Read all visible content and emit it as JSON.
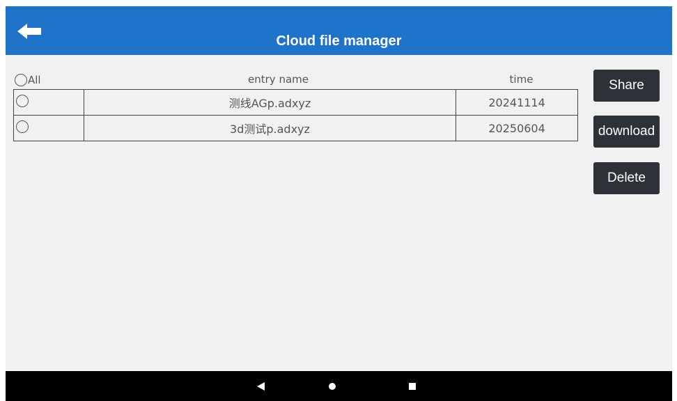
{
  "app_bar": {
    "title": "Cloud file manager",
    "back_icon": "arrow-left-icon",
    "color": "#1f73c9"
  },
  "table": {
    "select_all_label": "All",
    "columns": [
      "entry name",
      "time"
    ],
    "rows": [
      {
        "name": "测线AGp.adxyz",
        "time": "20241114",
        "selected": false
      },
      {
        "name": "3d测试p.adxyz",
        "time": "20250604",
        "selected": false
      }
    ]
  },
  "actions": {
    "share": "Share",
    "download": "download",
    "delete": "Delete"
  },
  "nav_bar": {
    "icons": [
      "nav-back-icon",
      "nav-home-icon",
      "nav-recents-icon"
    ]
  }
}
